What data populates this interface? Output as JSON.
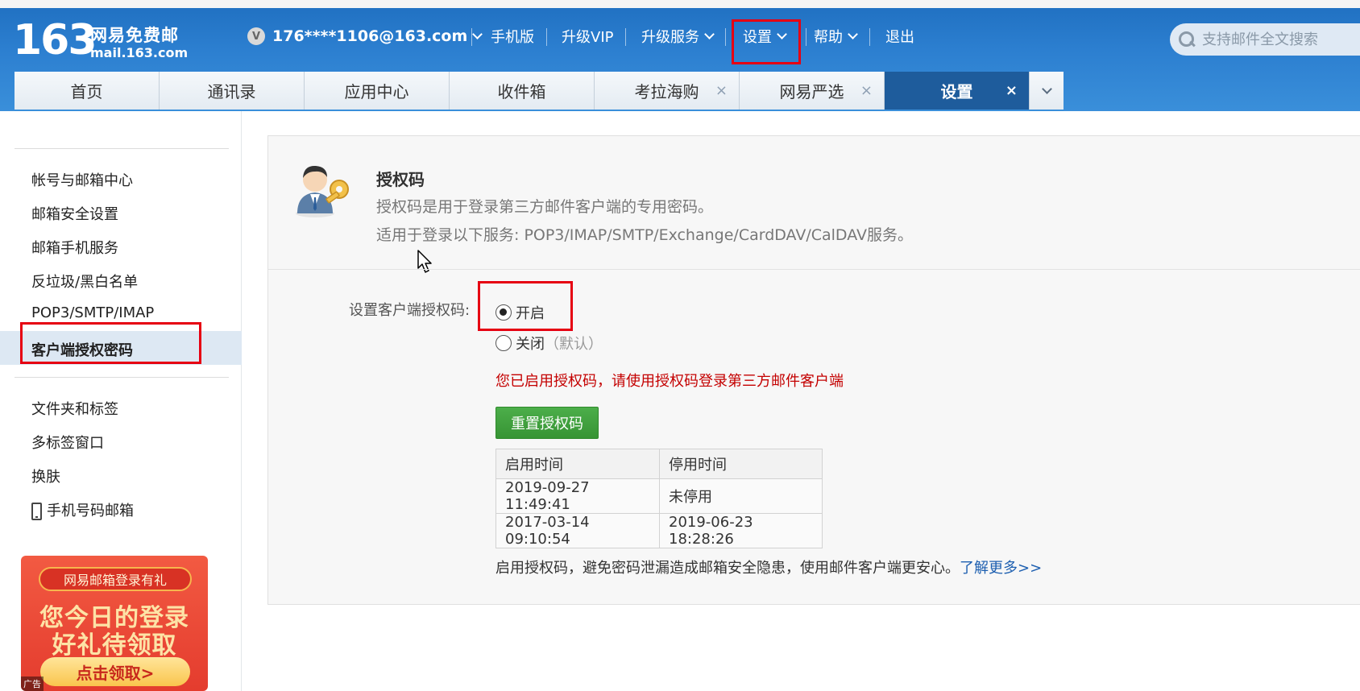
{
  "header": {
    "logo_number": "163",
    "logo_cn": "网易免费邮",
    "logo_url": "mail.163.com",
    "vip_badge": "V",
    "user_email": "176****1106@163.com",
    "nav": {
      "mobile": "手机版",
      "upgrade_vip": "升级VIP",
      "upgrade_service": "升级服务",
      "settings": "设置",
      "help": "帮助",
      "logout": "退出"
    },
    "search_placeholder": "支持邮件全文搜索"
  },
  "tabs": [
    {
      "label": "首页"
    },
    {
      "label": "通讯录"
    },
    {
      "label": "应用中心"
    },
    {
      "label": "收件箱"
    },
    {
      "label": "考拉海购",
      "close": "×"
    },
    {
      "label": "网易严选",
      "close": "×"
    },
    {
      "label": "设置",
      "close": "×",
      "active": true
    }
  ],
  "sidebar": {
    "items": [
      "帐号与邮箱中心",
      "邮箱安全设置",
      "邮箱手机服务",
      "反垃圾/黑白名单",
      "POP3/SMTP/IMAP",
      "客户端授权密码"
    ],
    "items2": [
      "文件夹和标签",
      "多标签窗口",
      "换肤",
      "手机号码邮箱"
    ],
    "active_index": 5
  },
  "ad": {
    "ribbon": "网易邮箱登录有礼",
    "line1": "您今日的登录",
    "line2": "好礼待领取",
    "button": "点击领取>",
    "tag": "广告"
  },
  "main": {
    "title": "授权码",
    "desc1": "授权码是用于登录第三方邮件客户端的专用密码。",
    "desc2": "适用于登录以下服务: POP3/IMAP/SMTP/Exchange/CardDAV/CalDAV服务。",
    "setting_label": "设置客户端授权码:",
    "radio_on": "开启",
    "radio_off": "关闭",
    "radio_off_default": "（默认）",
    "radio_on_checked": true,
    "enabled_message": "您已启用授权码，请使用授权码登录第三方邮件客户端",
    "reset_button": "重置授权码",
    "table": {
      "headers": [
        "启用时间",
        "停用时间"
      ],
      "rows": [
        [
          "2019-09-27 11:49:41",
          "未停用"
        ],
        [
          "2017-03-14 09:10:54",
          "2019-06-23 18:28:26"
        ]
      ]
    },
    "footer_note": "启用授权码，避免密码泄漏造成邮箱安全隐患，使用邮件客户端更安心。",
    "learn_more": "了解更多>>"
  },
  "colors": {
    "header_blue": "#2c7fd0",
    "active_tab": "#1e5c9c",
    "highlight_red": "#e60012",
    "success_green": "#43a541",
    "warning_red": "#c40000",
    "link_blue": "#1d5fb0"
  }
}
